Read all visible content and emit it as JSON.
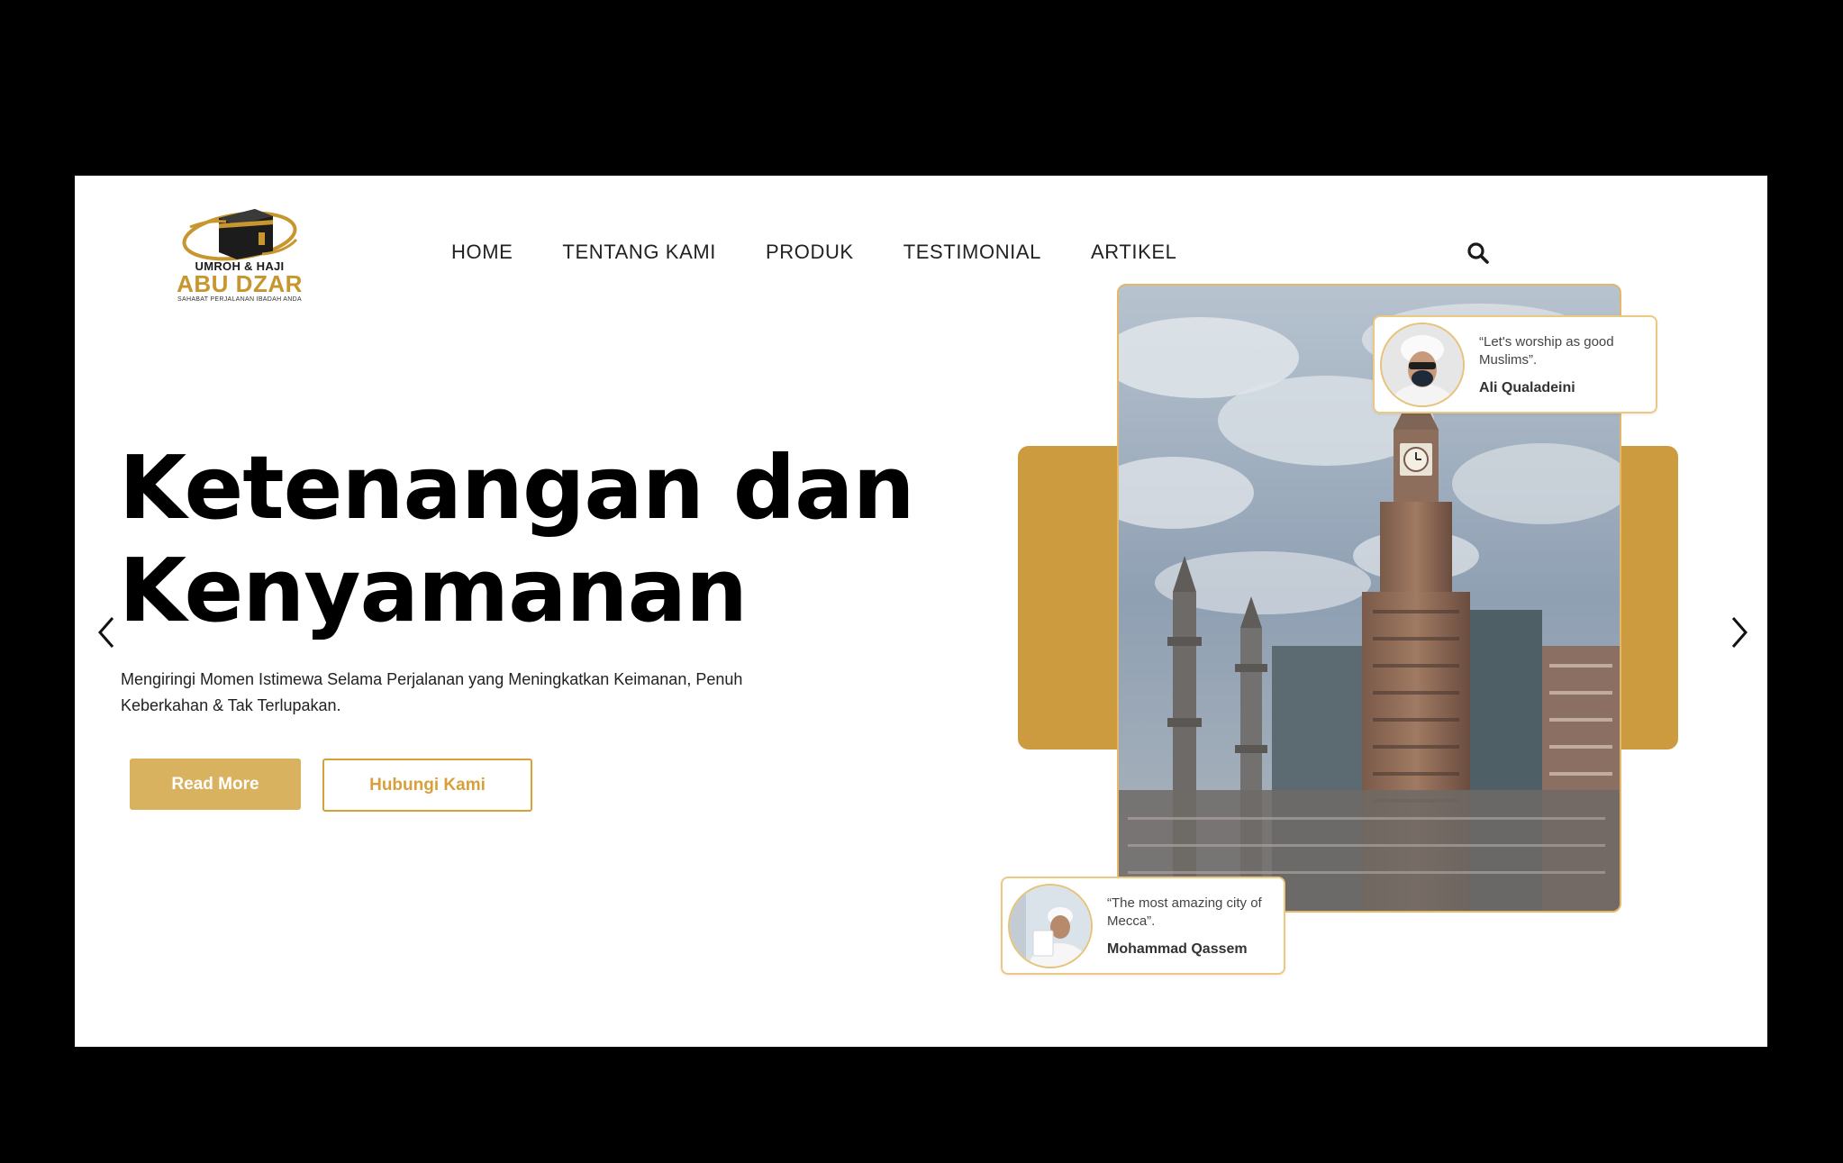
{
  "brand": {
    "line1": "UMROH & HAJI",
    "line2": "ABU DZAR",
    "line3": "SAHABAT PERJALANAN IBADAH ANDA"
  },
  "nav": {
    "home": "HOME",
    "about": "TENTANG KAMI",
    "product": "PRODUK",
    "testimonial": "TESTIMONIAL",
    "article": "ARTIKEL"
  },
  "hero": {
    "title_line1": "Ketenangan dan",
    "title_line2": "Kenyamanan",
    "description": "Mengiringi Momen Istimewa Selama Perjalanan yang Meningkatkan Keimanan, Penuh Keberkahan & Tak Terlupakan.",
    "btn_read_more": "Read More",
    "btn_contact": "Hubungi Kami"
  },
  "testimonials": [
    {
      "quote": "“Let's worship as good Muslims”.",
      "author": "Ali Qualadeini"
    },
    {
      "quote": "“The most amazing city of Mecca”.",
      "author": "Mohammad Qassem"
    }
  ],
  "icons": {
    "search": "search-icon",
    "prev": "chevron-left-icon",
    "next": "chevron-right-icon"
  },
  "colors": {
    "gold": "#cd9b3f",
    "button_gold": "#d8b25e",
    "outline_gold": "#d8a03a",
    "page_bg": "#ffffff",
    "frame_bg": "#000000"
  }
}
